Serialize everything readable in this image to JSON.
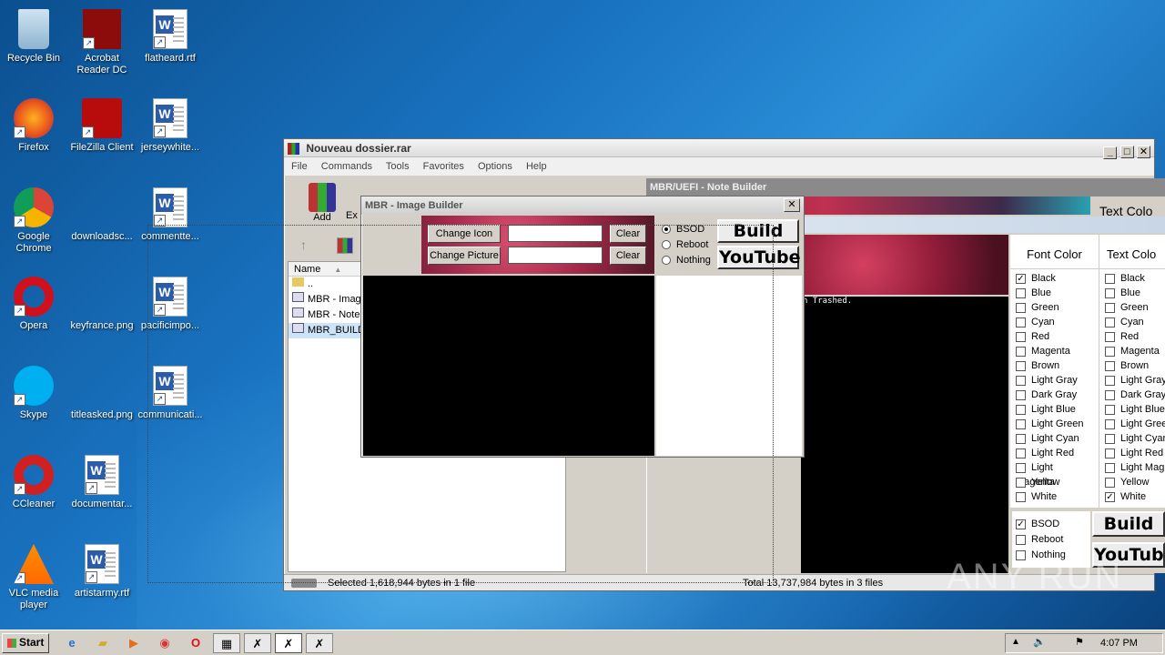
{
  "desktop": {
    "icons": [
      {
        "label": "Recycle Bin"
      },
      {
        "label": "Acrobat Reader DC"
      },
      {
        "label": "flatheard.rtf"
      },
      {
        "label": "Firefox"
      },
      {
        "label": "FileZilla Client"
      },
      {
        "label": "jerseywhite..."
      },
      {
        "label": "Google Chrome"
      },
      {
        "label": "downloadsc..."
      },
      {
        "label": "commentte..."
      },
      {
        "label": "Opera"
      },
      {
        "label": "keyfrance.png"
      },
      {
        "label": "pacificimpo..."
      },
      {
        "label": "Skype"
      },
      {
        "label": "titleasked.png"
      },
      {
        "label": "communicati..."
      },
      {
        "label": "CCleaner"
      },
      {
        "label": "documentar..."
      },
      {
        "label": "VLC media player"
      },
      {
        "label": "artistarmy.rtf"
      }
    ]
  },
  "winrar": {
    "title": "Nouveau dossier.rar",
    "menu": [
      "File",
      "Commands",
      "Tools",
      "Favorites",
      "Options",
      "Help"
    ],
    "toolbar_add": "Add",
    "toolbar_ex": "Ex",
    "column_name": "Name",
    "files": [
      "..",
      "MBR - Image",
      "MBR - Note",
      "MBR_BUILD"
    ],
    "status_left": "Selected 1,618,944 bytes in 1 file",
    "status_right": "Total 13,737,984 bytes in 3 files"
  },
  "note_builder": {
    "title": "MBR/UEFI - Note Builder",
    "text_color_top": "Text Colo",
    "font_color_header": "Font Color",
    "text_color_header": "Text Colo",
    "console_text": "n Trashed.",
    "font_colors": [
      "Black",
      "Blue",
      "Green",
      "Cyan",
      "Red",
      "Magenta",
      "Brown",
      "Light Gray",
      "Dark Gray",
      "Light Blue",
      "Light Green",
      "Light Cyan",
      "Light Red",
      "Light Magenta",
      "Yellow",
      "White"
    ],
    "text_colors": [
      "Black",
      "Blue",
      "Green",
      "Cyan",
      "Red",
      "Magenta",
      "Brown",
      "Light Gray",
      "Dark Gray",
      "Light Blue",
      "Light Gree",
      "Light Cyan",
      "Light Red",
      "Light Mag",
      "Yellow",
      "White"
    ],
    "font_checked": "Black",
    "text_checked": "White",
    "opt_bsod": "BSOD",
    "opt_reboot": "Reboot",
    "opt_nothing": "Nothing",
    "build_label": "Build",
    "youtube_label": "YouTub"
  },
  "image_builder": {
    "title": "MBR - Image Builder",
    "change_icon": "Change Icon",
    "change_picture": "Change Picture",
    "clear": "Clear",
    "opt_bsod": "BSOD",
    "opt_reboot": "Reboot",
    "opt_nothing": "Nothing",
    "build_label": "Build",
    "youtube_label": "YouTube"
  },
  "taskbar": {
    "start_label": "Start",
    "clock": "4:07 PM"
  },
  "watermark": "ANY RUN"
}
